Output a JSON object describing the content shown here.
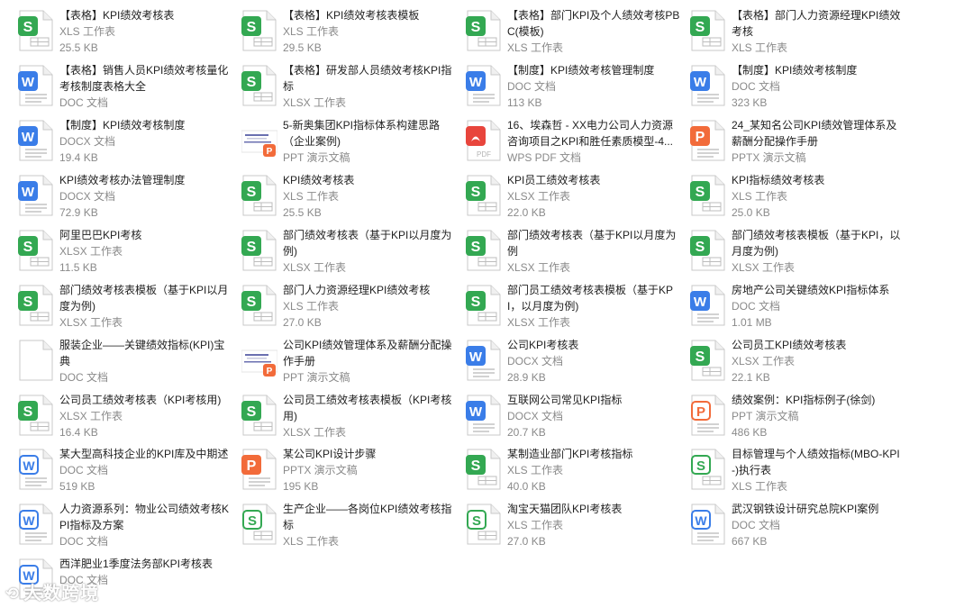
{
  "files": [
    {
      "name": "【表格】KPI绩效考核表",
      "type": "XLS 工作表",
      "size": "25.5 KB",
      "icon": "spreadsheet-icon"
    },
    {
      "name": "【表格】KPI绩效考核表模板",
      "type": "XLS 工作表",
      "size": "29.5 KB",
      "icon": "spreadsheet-icon"
    },
    {
      "name": "【表格】部门KPI及个人绩效考核PBC(模板)",
      "type": "XLS 工作表",
      "size": "",
      "icon": "spreadsheet-icon"
    },
    {
      "name": "【表格】部门人力资源经理KPI绩效考核",
      "type": "XLS 工作表",
      "size": "",
      "icon": "spreadsheet-icon"
    },
    {
      "name": "【表格】销售人员KPI绩效考核量化考核制度表格大全",
      "type": "DOC 文档",
      "size": "",
      "icon": "word-icon"
    },
    {
      "name": "【表格】研发部人员绩效考核KPI指标",
      "type": "XLSX 工作表",
      "size": "",
      "icon": "spreadsheet-icon"
    },
    {
      "name": "【制度】KPI绩效考核管理制度",
      "type": "DOC 文档",
      "size": "113 KB",
      "icon": "word-icon"
    },
    {
      "name": "【制度】KPI绩效考核制度",
      "type": "DOC 文档",
      "size": "323 KB",
      "icon": "word-icon"
    },
    {
      "name": "【制度】KPI绩效考核制度",
      "type": "DOCX 文档",
      "size": "19.4 KB",
      "icon": "word-icon"
    },
    {
      "name": "5-新奥集团KPI指标体系构建思路（企业案例)",
      "type": "PPT 演示文稿",
      "size": "",
      "icon": "ppt-thumbnail-icon"
    },
    {
      "name": "16、埃森哲 - XX电力公司人力资源咨询项目之KPI和胜任素质模型-4...",
      "type": "WPS PDF 文档",
      "size": "",
      "icon": "pdf-icon"
    },
    {
      "name": "24_某知名公司KPI绩效管理体系及薪酬分配操作手册",
      "type": "PPTX 演示文稿",
      "size": "",
      "icon": "presentation-icon"
    },
    {
      "name": "KPI绩效考核办法管理制度",
      "type": "DOCX 文档",
      "size": "72.9 KB",
      "icon": "word-icon"
    },
    {
      "name": "KPI绩效考核表",
      "type": "XLS 工作表",
      "size": "25.5 KB",
      "icon": "spreadsheet-icon"
    },
    {
      "name": "KPI员工绩效考核表",
      "type": "XLSX 工作表",
      "size": "22.0 KB",
      "icon": "spreadsheet-icon"
    },
    {
      "name": "KPI指标绩效考核表",
      "type": "XLS 工作表",
      "size": "25.0 KB",
      "icon": "spreadsheet-icon"
    },
    {
      "name": "阿里巴巴KPI考核",
      "type": "XLSX 工作表",
      "size": "11.5 KB",
      "icon": "spreadsheet-icon"
    },
    {
      "name": "部门绩效考核表（基于KPI以月度为例)",
      "type": "XLSX 工作表",
      "size": "",
      "icon": "spreadsheet-icon"
    },
    {
      "name": "部门绩效考核表（基于KPI以月度为例",
      "type": "XLSX 工作表",
      "size": "",
      "icon": "spreadsheet-icon"
    },
    {
      "name": "部门绩效考核表模板（基于KPI，以月度为例)",
      "type": "XLSX 工作表",
      "size": "",
      "icon": "spreadsheet-icon"
    },
    {
      "name": "部门绩效考核表模板（基于KPI以月度为例)",
      "type": "XLSX 工作表",
      "size": "",
      "icon": "spreadsheet-icon"
    },
    {
      "name": "部门人力资源经理KPI绩效考核",
      "type": "XLS 工作表",
      "size": "27.0 KB",
      "icon": "spreadsheet-icon"
    },
    {
      "name": "部门员工绩效考核表模板（基于KPI，以月度为例)",
      "type": "XLSX 工作表",
      "size": "",
      "icon": "spreadsheet-icon"
    },
    {
      "name": "房地产公司关键绩效KPI指标体系",
      "type": "DOC 文档",
      "size": "1.01 MB",
      "icon": "word-icon"
    },
    {
      "name": "服装企业——关键绩效指标(KPI)宝典",
      "type": "DOC 文档",
      "size": "",
      "icon": "blank-doc-icon"
    },
    {
      "name": "公司KPI绩效管理体系及薪酬分配操作手册",
      "type": "PPT 演示文稿",
      "size": "",
      "icon": "ppt-thumbnail-icon"
    },
    {
      "name": "公司KPI考核表",
      "type": "DOCX 文档",
      "size": "28.9 KB",
      "icon": "word-icon"
    },
    {
      "name": "公司员工KPI绩效考核表",
      "type": "XLSX 工作表",
      "size": "22.1 KB",
      "icon": "spreadsheet-icon"
    },
    {
      "name": "公司员工绩效考核表（KPI考核用)",
      "type": "XLSX 工作表",
      "size": "16.4 KB",
      "icon": "spreadsheet-icon"
    },
    {
      "name": "公司员工绩效考核表模板（KPI考核用)",
      "type": "XLSX 工作表",
      "size": "",
      "icon": "spreadsheet-icon"
    },
    {
      "name": "互联网公司常见KPI指标",
      "type": "DOCX 文档",
      "size": "20.7 KB",
      "icon": "word-icon"
    },
    {
      "name": "绩效案例：KPI指标例子(徐剑)",
      "type": "PPT 演示文稿",
      "size": "486 KB",
      "icon": "presentation-outline-icon"
    },
    {
      "name": "某大型高科技企业的KPI库及中期述",
      "type": "DOC 文档",
      "size": "519 KB",
      "icon": "word-outline-icon"
    },
    {
      "name": "某公司KPI设计步骤",
      "type": "PPTX 演示文稿",
      "size": "195 KB",
      "icon": "presentation-icon"
    },
    {
      "name": "某制造业部门KPI考核指标",
      "type": "XLS 工作表",
      "size": "40.0 KB",
      "icon": "spreadsheet-icon"
    },
    {
      "name": "目标管理与个人绩效指标(MBO-KPI-)执行表",
      "type": "XLS 工作表",
      "size": "",
      "icon": "spreadsheet-outline-icon"
    },
    {
      "name": "人力资源系列：物业公司绩效考核KPI指标及方案",
      "type": "DOC 文档",
      "size": "",
      "icon": "word-outline-icon"
    },
    {
      "name": "生产企业——各岗位KPI绩效考核指标",
      "type": "XLS 工作表",
      "size": "",
      "icon": "spreadsheet-outline-icon"
    },
    {
      "name": "淘宝天猫团队KPI考核表",
      "type": "XLS 工作表",
      "size": "27.0 KB",
      "icon": "spreadsheet-outline-icon"
    },
    {
      "name": "武汉钢铁设计研究总院KPI案例",
      "type": "DOC 文档",
      "size": "667 KB",
      "icon": "word-outline-icon"
    },
    {
      "name": "西洋肥业1季度法务部KPI考核表",
      "type": "DOC 文档",
      "size": "",
      "icon": "word-outline-icon"
    }
  ],
  "colors": {
    "spreadsheet": "#33a852",
    "word": "#3a7de8",
    "presentation": "#f26b3a",
    "pdf": "#e8453c",
    "text": "#222222",
    "meta": "#8a8a8a"
  },
  "watermark": {
    "text": "大数跨境"
  }
}
